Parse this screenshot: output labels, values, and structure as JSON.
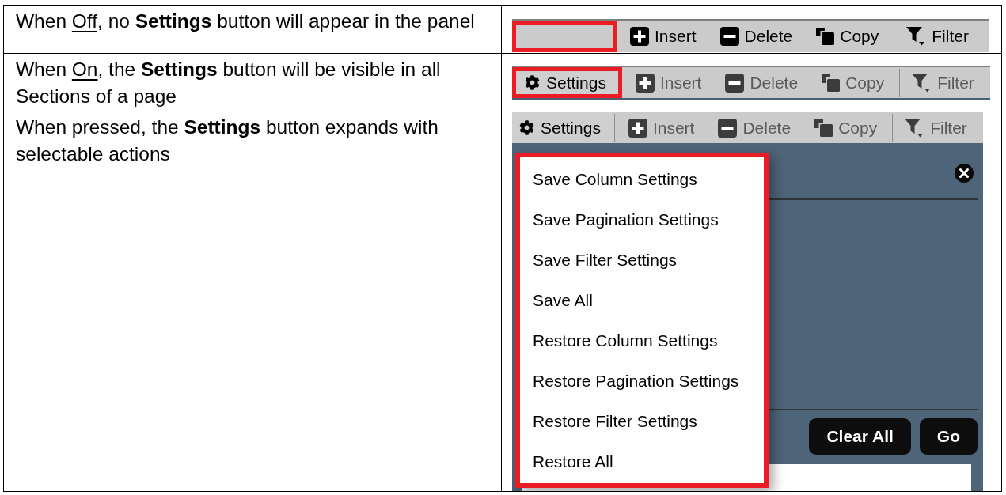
{
  "rows": [
    {
      "description": [
        {
          "text": "When ",
          "kind": "plain"
        },
        {
          "text": "Off",
          "kind": "underlined"
        },
        {
          "text": ", no **Settings** button will appear in the panel",
          "kind": "plain"
        }
      ],
      "toolbar": {
        "highlighted": true,
        "buttons": [
          {
            "label": "Insert",
            "kind": "plus",
            "disabled": false,
            "separator_before": false
          },
          {
            "label": "Delete",
            "kind": "minus",
            "disabled": false,
            "separator_before": false
          },
          {
            "label": "Copy",
            "kind": "copy",
            "disabled": false,
            "separator_before": false
          },
          {
            "label": "Filter",
            "kind": "filter",
            "disabled": false,
            "separator_before": true
          }
        ]
      }
    },
    {
      "description": [
        {
          "text": "When ",
          "kind": "plain"
        },
        {
          "text": "On",
          "kind": "underlined"
        },
        {
          "text": ", the **Settings** button will be visible in all Sections of a page",
          "kind": "plain"
        }
      ],
      "toolbar": {
        "highlighted": true,
        "settings": {
          "label": "Settings"
        },
        "buttons": [
          {
            "label": "Insert",
            "kind": "plus",
            "disabled": true,
            "separator_before": false
          },
          {
            "label": "Delete",
            "kind": "minus",
            "disabled": true,
            "separator_before": false
          },
          {
            "label": "Copy",
            "kind": "copy",
            "disabled": true,
            "separator_before": false
          },
          {
            "label": "Filter",
            "kind": "filter",
            "disabled": true,
            "separator_before": true
          }
        ]
      }
    },
    {
      "description": [
        {
          "text": "When pressed, the **Settings** button expands with selectable actions",
          "kind": "plain"
        }
      ],
      "toolbar": {
        "highlighted": false,
        "settings": {
          "label": "Settings"
        },
        "buttons": [
          {
            "label": "Insert",
            "kind": "plus",
            "disabled": true,
            "separator_before": false
          },
          {
            "label": "Delete",
            "kind": "minus",
            "disabled": true,
            "separator_before": false
          },
          {
            "label": "Copy",
            "kind": "copy",
            "disabled": true,
            "separator_before": false
          },
          {
            "label": "Filter",
            "kind": "filter",
            "disabled": true,
            "separator_before": true
          }
        ]
      },
      "panel": {
        "menu": {
          "highlighted": true,
          "items": [
            "Save Column Settings",
            "Save Pagination Settings",
            "Save Filter Settings",
            "Save All",
            "Restore Column Settings",
            "Restore Pagination Settings",
            "Restore Filter Settings",
            "Restore All"
          ]
        },
        "buttons": [
          "Clear All",
          "Go"
        ]
      }
    }
  ]
}
